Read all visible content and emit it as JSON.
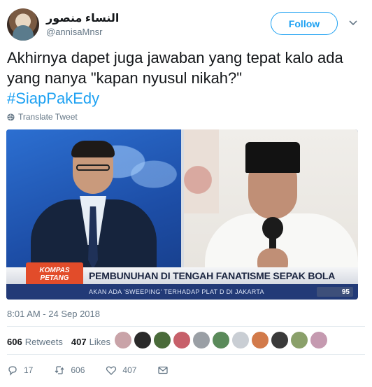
{
  "tweet": {
    "author": {
      "display_name": "النساء منصور",
      "handle": "@annisaMnsr",
      "avatar_icon": "user-avatar"
    },
    "follow_button": {
      "label": "Follow",
      "color": "#1da1f2"
    },
    "text": "Akhirnya dapet juga jawaban yang tepat kalo ada yang nanya \"kapan nyusul nikah?\"",
    "hashtag": "#SiapPakEdy",
    "translate_label": "Translate Tweet",
    "media": {
      "ticker_headline": "PEMBUNUHAN DI TENGAH FANATISME SEPAK BOLA",
      "show_logo_line1": "KOMPAS",
      "show_logo_line2": "PETANG",
      "sub_ticker_text": "AKAN ADA 'SWEEPING' TERHADAP PLAT D DI JAKARTA",
      "channel_number": "95"
    },
    "timestamp": "8:01 AM - 24 Sep 2018",
    "stats": {
      "retweets_count": "606",
      "retweets_label": "Retweets",
      "likes_count": "407",
      "likes_label": "Likes"
    },
    "liker_avatar_colors": [
      "#c9a3a8",
      "#2a2a2a",
      "#4a6b3a",
      "#c7606a",
      "#9a9fa5",
      "#5a8a5a",
      "#c9ced4",
      "#d27a4a",
      "#3a3a3a",
      "#8aa06a",
      "#c59ab0"
    ],
    "actions": {
      "reply_count": "17",
      "retweet_count": "606",
      "like_count": "407",
      "reply_icon": "reply-icon",
      "retweet_icon": "retweet-icon",
      "like_icon": "heart-icon",
      "message_icon": "envelope-icon"
    },
    "accent_color": "#1da1f2",
    "muted_color": "#657786"
  }
}
